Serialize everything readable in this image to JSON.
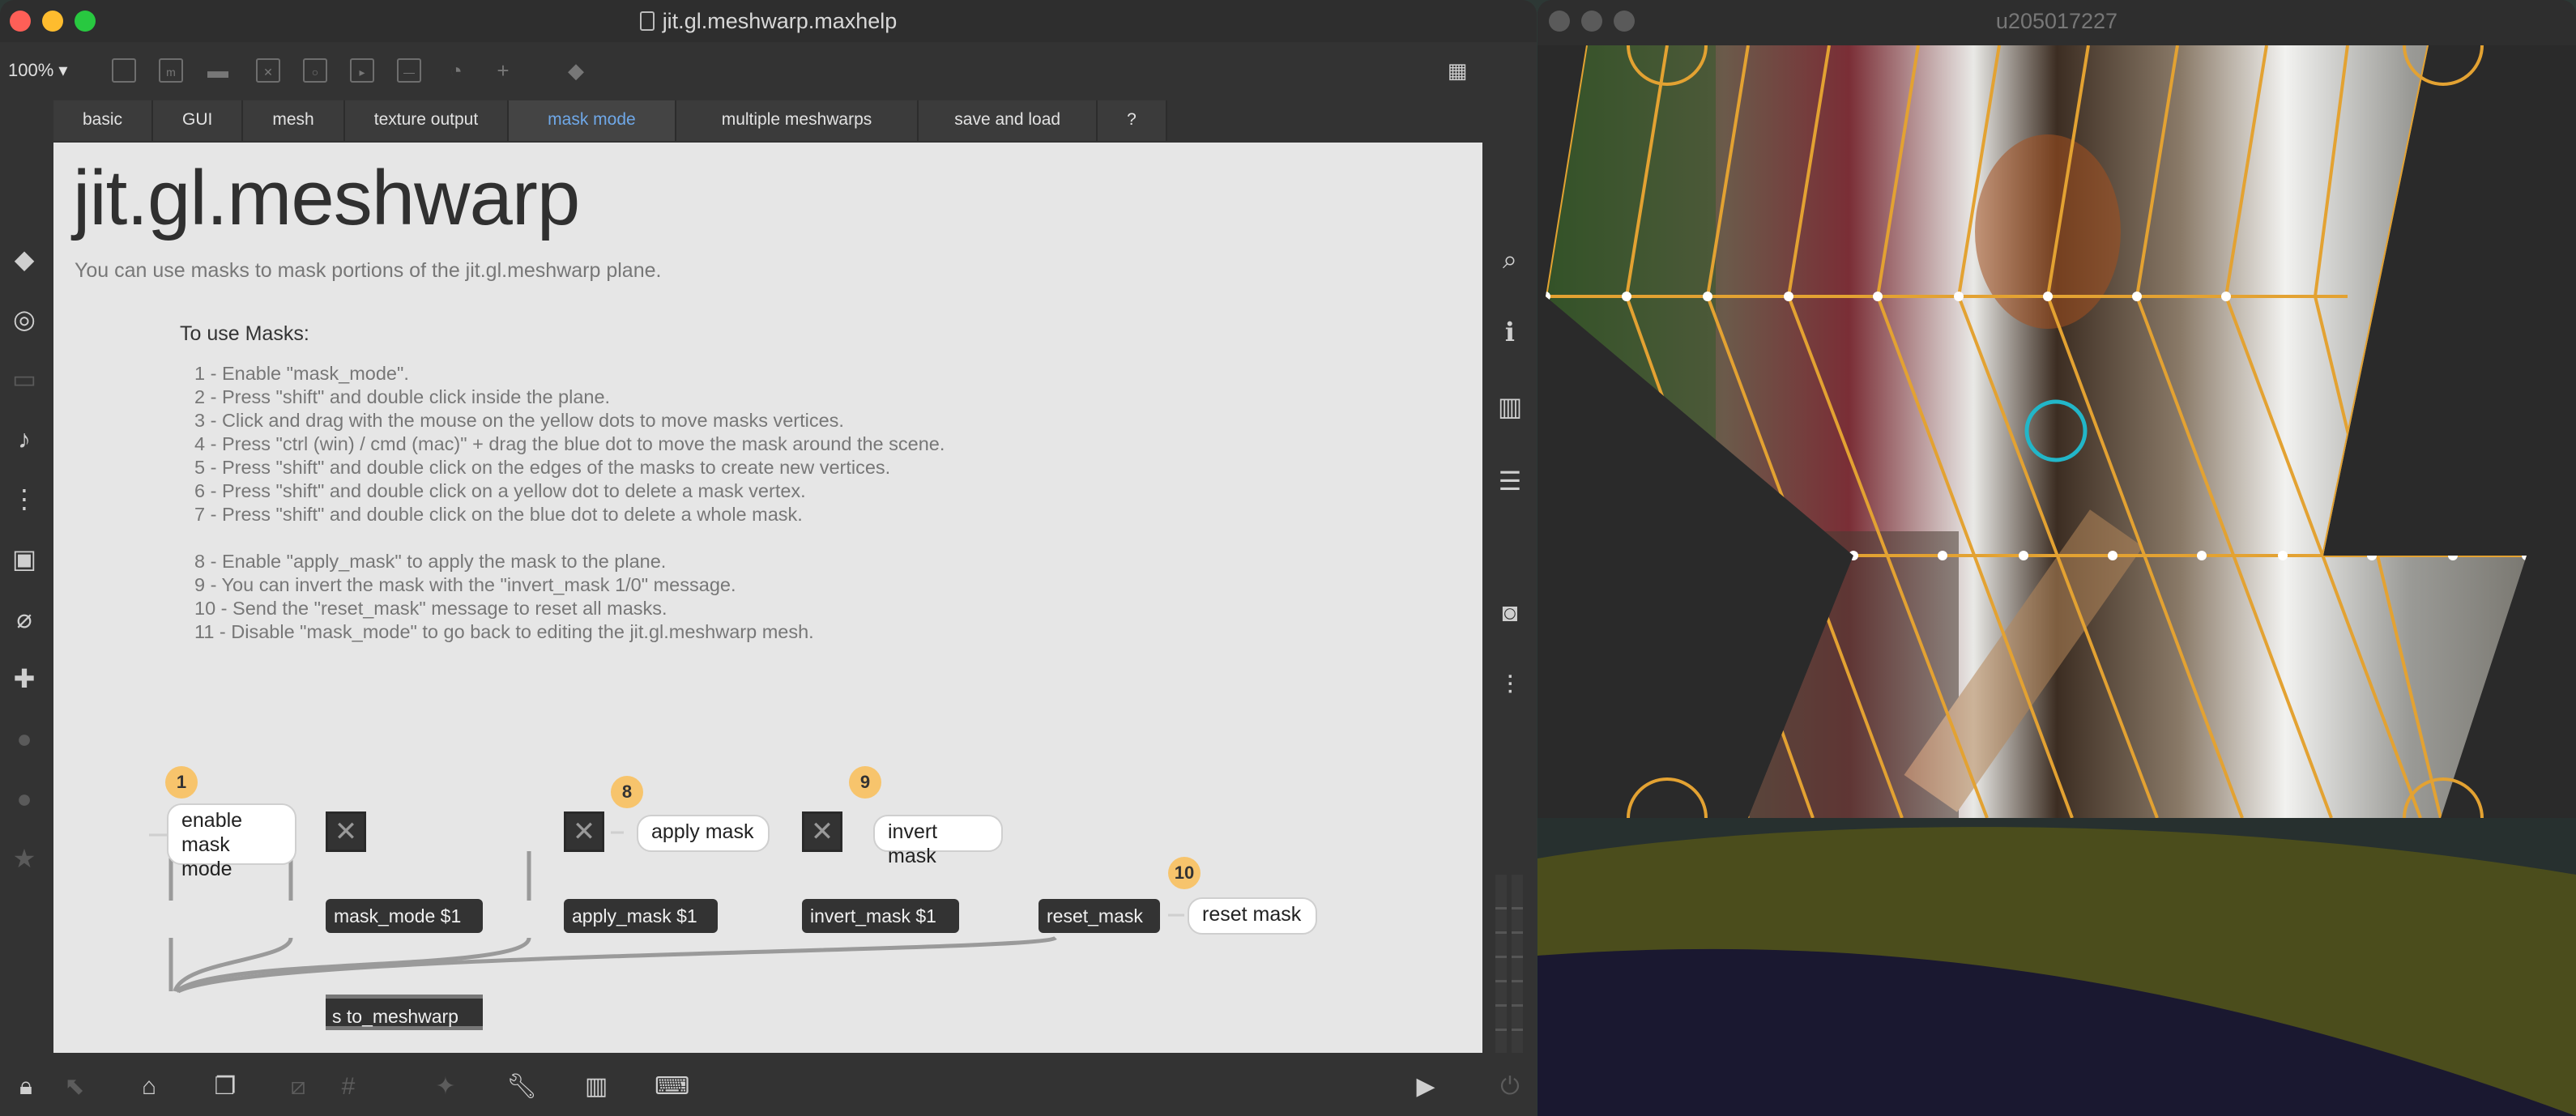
{
  "max_window": {
    "title": "jit.gl.meshwarp.maxhelp",
    "zoom": "100%",
    "tabs": [
      "basic",
      "GUI",
      "mesh",
      "texture output",
      "mask mode",
      "multiple meshwarps",
      "save and load",
      "?"
    ],
    "active_tab": "mask mode",
    "heading": "jit.gl.meshwarp",
    "description": "You can use masks to mask portions of the jit.gl.meshwarp plane.",
    "instructions_title": "To use Masks:",
    "instructions": [
      "1 - Enable \"mask_mode\".",
      "2 - Press \"shift\" and double click inside the plane.",
      "3 - Click and drag with the mouse on the yellow dots to move masks vertices.",
      "4 - Press \"ctrl (win) / cmd (mac)\" + drag the blue dot to move the mask around the scene.",
      "5 - Press \"shift\" and double click on the edges of the masks to create new vertices.",
      "6 - Press \"shift\" and double click on a yellow dot to delete a mask vertex.",
      "7 - Press \"shift\" and double click on the blue dot to delete a whole mask.",
      "8 - Enable \"apply_mask\" to apply the mask to the plane.",
      "9 - You can invert the mask with the \"invert_mask 1/0\" message.",
      "10 - Send the \"reset_mask\" message to reset all masks.",
      "11 - Disable \"mask_mode\" to go back to editing the jit.gl.meshwarp mesh."
    ],
    "patch": {
      "badges": [
        "1",
        "8",
        "9",
        "10"
      ],
      "comments": {
        "enable_mask_mode_1": "enable",
        "enable_mask_mode_2": "mask mode",
        "apply_mask": "apply mask",
        "invert_mask": "invert mask",
        "reset_mask": "reset mask"
      },
      "messages": {
        "mask_mode": "mask_mode $1",
        "apply_mask": "apply_mask $1",
        "invert_mask": "invert_mask $1",
        "reset_mask": "reset_mask"
      },
      "send_object": "s to_meshwarp"
    }
  },
  "jit_window": {
    "title": "u205017227"
  },
  "colors": {
    "accent_tab": "#6fa8e8",
    "badge": "#f7c46c",
    "mesh_lines": "#e3a232",
    "mask_handle": "#22b6c8",
    "close": "#fe5f57",
    "minimize": "#febc2e",
    "maximize": "#28c840"
  }
}
